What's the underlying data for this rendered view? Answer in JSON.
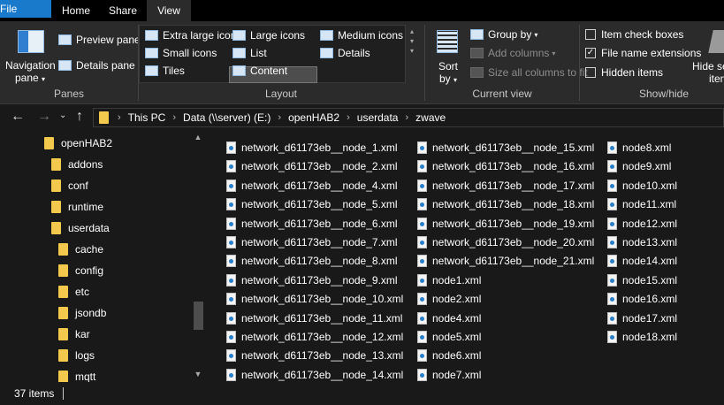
{
  "tabs": [
    {
      "label": "File"
    },
    {
      "label": "Home"
    },
    {
      "label": "Share"
    },
    {
      "label": "View"
    }
  ],
  "ribbon": {
    "panes": {
      "navigation_pane": "Navigation",
      "navigation_pane_sub": "pane",
      "preview_pane": "Preview pane",
      "details_pane": "Details pane",
      "group_label": "Panes"
    },
    "layout": {
      "items": [
        "Extra large icons",
        "Large icons",
        "Medium icons",
        "Small icons",
        "List",
        "Details",
        "Tiles",
        "Content"
      ],
      "selected": "List",
      "group_label": "Layout"
    },
    "current_view": {
      "sort_by": "Sort",
      "sort_by_sub": "by",
      "group_by": "Group by",
      "add_columns": "Add columns",
      "size_columns": "Size all columns to fit",
      "group_label": "Current view"
    },
    "show_hide": {
      "item_check_boxes": "Item check boxes",
      "file_name_extensions": "File name extensions",
      "hidden_items": "Hidden items",
      "hide_selected": "Hide sel",
      "hide_selected_sub": "item",
      "group_label": "Show/hide",
      "checked": {
        "item_check_boxes": false,
        "file_name_extensions": true,
        "hidden_items": false
      }
    }
  },
  "address": {
    "crumbs": [
      "This PC",
      "Data (\\\\server) (E:)",
      "openHAB2",
      "userdata",
      "zwave"
    ]
  },
  "nav_tree": [
    {
      "label": "openHAB2",
      "level": 0
    },
    {
      "label": "addons",
      "level": 1
    },
    {
      "label": "conf",
      "level": 1
    },
    {
      "label": "runtime",
      "level": 1
    },
    {
      "label": "userdata",
      "level": 1
    },
    {
      "label": "cache",
      "level": 2
    },
    {
      "label": "config",
      "level": 2
    },
    {
      "label": "etc",
      "level": 2
    },
    {
      "label": "jsondb",
      "level": 2
    },
    {
      "label": "kar",
      "level": 2
    },
    {
      "label": "logs",
      "level": 2
    },
    {
      "label": "mqtt",
      "level": 2
    }
  ],
  "files": {
    "col1": [
      "network_d61173eb__node_1.xml",
      "network_d61173eb__node_2.xml",
      "network_d61173eb__node_4.xml",
      "network_d61173eb__node_5.xml",
      "network_d61173eb__node_6.xml",
      "network_d61173eb__node_7.xml",
      "network_d61173eb__node_8.xml",
      "network_d61173eb__node_9.xml",
      "network_d61173eb__node_10.xml",
      "network_d61173eb__node_11.xml",
      "network_d61173eb__node_12.xml",
      "network_d61173eb__node_13.xml",
      "network_d61173eb__node_14.xml"
    ],
    "col2": [
      "network_d61173eb__node_15.xml",
      "network_d61173eb__node_16.xml",
      "network_d61173eb__node_17.xml",
      "network_d61173eb__node_18.xml",
      "network_d61173eb__node_19.xml",
      "network_d61173eb__node_20.xml",
      "network_d61173eb__node_21.xml",
      "node1.xml",
      "node2.xml",
      "node4.xml",
      "node5.xml",
      "node6.xml",
      "node7.xml"
    ],
    "col3": [
      "node8.xml",
      "node9.xml",
      "node10.xml",
      "node11.xml",
      "node12.xml",
      "node13.xml",
      "node14.xml",
      "node15.xml",
      "node16.xml",
      "node17.xml",
      "node18.xml"
    ]
  },
  "status": {
    "item_count": "37 items"
  },
  "colors": {
    "accent": "#1979ca",
    "background": "#191919",
    "ribbon": "#2b2b2b",
    "folder": "#f2c94c"
  }
}
